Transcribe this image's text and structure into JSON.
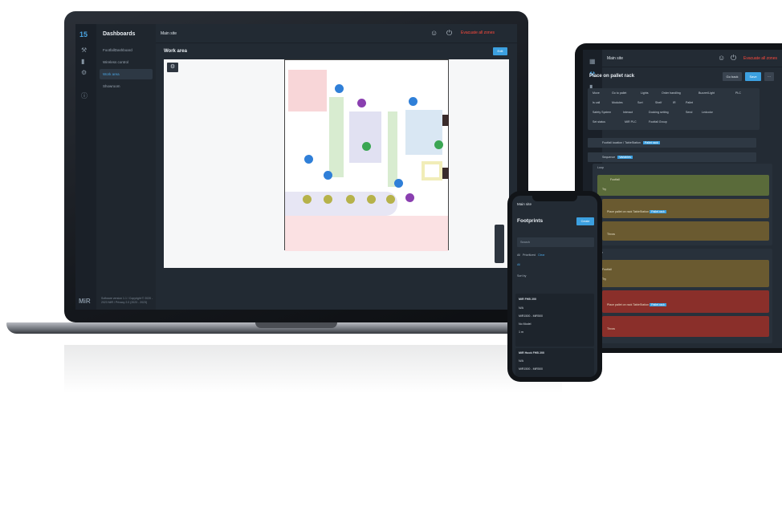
{
  "laptop": {
    "logo": "15",
    "brand": "MiR",
    "sidebar_title": "Dashboards",
    "sidebar_items": [
      "FootfallDashboard",
      "Wireless control",
      "Work area",
      "Showroom"
    ],
    "sidebar_footer": "Software version 1.1 / Copyright © 2020 - 2023 MiR / Privacy 2.0 (2023 - 2023)",
    "site": "Main site",
    "evacuate": "Evacuate all zones",
    "work_area_title": "Work area",
    "edit_label": "Edit"
  },
  "tablet": {
    "site": "Main site",
    "title": "Place on pallet rack",
    "btn_secondary": "Go back",
    "btn_primary": "Save",
    "chips": [
      "Move",
      "Go to pallet",
      "Lights",
      "Order handling",
      "Buzzer/Light",
      "PLC",
      "Is call",
      "Modules",
      "Sort",
      "Shelf",
      "IR",
      "Pallet",
      "Safety System",
      "Interact",
      "Docking setting",
      "Send",
      "Ledcolor",
      "Set status",
      "MIR PLC",
      "Footfall Group"
    ],
    "rows": [
      {
        "label": "Footfall location / TableStation",
        "badge": "Pallet rack"
      },
      {
        "label": "Sequence",
        "badge": "Variables"
      }
    ],
    "section_labels": [
      "Loop",
      "Else"
    ],
    "card_labels": [
      "Footfall",
      "Try",
      "Place pallet on rack TableStation",
      "Throw",
      "Footfall",
      "Try",
      "Place pallet on rack TableStation",
      "Throw"
    ],
    "card_badges": [
      "Pallet rack",
      "Pallet rack"
    ]
  },
  "phone": {
    "site": "Main site",
    "title": "Footprints",
    "create_label": "Create",
    "search_placeholder": "Search",
    "filters": [
      "All",
      "Prioritized",
      "Clear"
    ],
    "sort": "Sort by",
    "items": [
      {
        "name": "MiR FHB 200",
        "lines": [
          "N/A",
          "MiR1500 - MiR500",
          "No Model",
          "1 m"
        ]
      },
      {
        "name": "MiR Hook FHB 200",
        "lines": [
          "N/A",
          "MiR1500 - MiR500",
          "N/A"
        ]
      }
    ]
  }
}
